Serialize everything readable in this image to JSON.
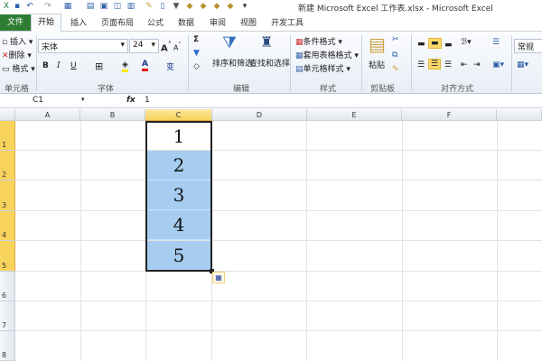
{
  "window": {
    "title": "新建 Microsoft Excel 工作表.xlsx  -  Microsoft Excel"
  },
  "tabs": {
    "file": "文件",
    "items": [
      "开始",
      "插入",
      "页面布局",
      "公式",
      "数据",
      "审阅",
      "视图",
      "开发工具"
    ]
  },
  "ribbon": {
    "cells": {
      "insert": "插入",
      "delete": "删除",
      "format": "格式",
      "group": "单元格"
    },
    "font": {
      "name": "宋体",
      "size": "24",
      "bold": "B",
      "italic": "I",
      "underline": "U",
      "group": "字体"
    },
    "editing": {
      "sum": "Σ",
      "sort_filter": "排序和筛选",
      "find_select": "查找和选择",
      "group": "编辑"
    },
    "styles": {
      "conditional": "条件格式",
      "table": "套用表格格式",
      "cell_styles": "单元格样式",
      "group": "样式"
    },
    "clipboard": {
      "paste": "粘贴",
      "group": "剪贴板"
    },
    "alignment": {
      "group": "对齐方式"
    },
    "number": {
      "format": "常规"
    }
  },
  "formula_bar": {
    "name_box": "C1",
    "fx": "fx",
    "value": "1"
  },
  "sheet": {
    "columns": [
      "A",
      "B",
      "C",
      "D",
      "E",
      "F"
    ],
    "rows": [
      "1",
      "2",
      "3",
      "4",
      "5",
      "6",
      "7",
      "8"
    ],
    "cells_c": [
      "1",
      "2",
      "3",
      "4",
      "5"
    ]
  }
}
